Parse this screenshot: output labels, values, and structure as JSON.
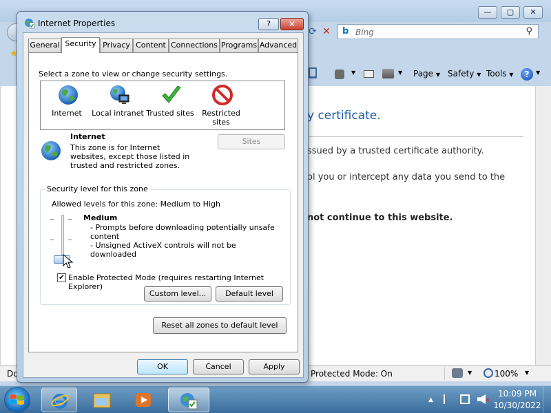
{
  "ie": {
    "search_engine": "Bing",
    "search_placeholder": "Bing",
    "commands": {
      "page": "Page",
      "safety": "Safety",
      "tools": "Tools"
    },
    "content": {
      "heading": "y certificate.",
      "line1": "ssued by a trusted certificate authority.",
      "line2": "ol you or intercept any data you send to the",
      "line3": "",
      "bold_line": "not continue to this website."
    },
    "status": {
      "left": "Do",
      "protected_mode": "Protected Mode: On",
      "zoom": "100%"
    }
  },
  "dialog": {
    "title": "Internet Properties",
    "help_label": "?",
    "close_label": "✕",
    "tabs": [
      {
        "label": "General"
      },
      {
        "label": "Security"
      },
      {
        "label": "Privacy"
      },
      {
        "label": "Content"
      },
      {
        "label": "Connections"
      },
      {
        "label": "Programs"
      },
      {
        "label": "Advanced"
      }
    ],
    "selected_tab": "Security",
    "zone_prompt": "Select a zone to view or change security settings.",
    "zones": [
      {
        "label": "Internet",
        "icon": "globe-icon"
      },
      {
        "label": "Local intranet",
        "icon": "intranet-icon"
      },
      {
        "label": "Trusted sites",
        "icon": "checkmark-icon"
      },
      {
        "label": "Restricted sites",
        "icon": "restricted-icon"
      }
    ],
    "selected_zone": "Internet",
    "zone_description": {
      "title": "Internet",
      "text": "This zone is for Internet websites, except those listed in trusted and restricted zones."
    },
    "sites_button": "Sites",
    "security_level": {
      "legend": "Security level for this zone",
      "allowed": "Allowed levels for this zone: Medium to High",
      "level_name": "Medium",
      "details": [
        "- Prompts before downloading potentially unsafe content",
        "- Unsigned ActiveX controls will not be downloaded"
      ],
      "protected_mode_checked": true,
      "protected_mode_label": "Enable Protected Mode (requires restarting Internet Explorer)",
      "custom_level_button": "Custom level...",
      "default_level_button": "Default level"
    },
    "reset_all_button": "Reset all zones to default level",
    "ok_button": "OK",
    "cancel_button": "Cancel",
    "apply_button": "Apply"
  },
  "taskbar": {
    "clock_time": "10:09 PM",
    "clock_date": "10/30/2022"
  },
  "colors": {
    "accent": "#1f5ea8",
    "taskbar_top": "#6f9ec6",
    "close_red": "#c8402f"
  }
}
